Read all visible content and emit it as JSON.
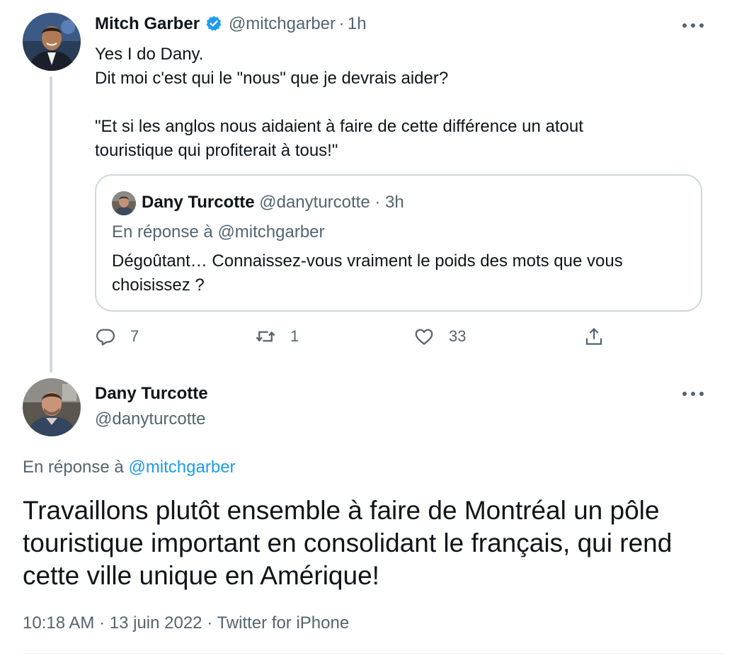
{
  "parent_tweet": {
    "author_name": "Mitch Garber",
    "author_handle": "@mitchgarber",
    "separator": "·",
    "time_ago": "1h",
    "lines": [
      "Yes I do Dany.",
      "Dit moi c'est qui le \"nous\" que je devrais aider?",
      "",
      "\"Et si les anglos nous aidaient à faire de cette différence un atout",
      "touristique qui profiterait à tous!\""
    ],
    "quote": {
      "author_name": "Dany Turcotte",
      "author_handle": "@danyturcotte",
      "separator": "·",
      "time_ago": "3h",
      "reply_to": "En réponse à @mitchgarber",
      "text": "Dégoûtant… Connaissez-vous vraiment le poids des mots que vous choisissez ?"
    },
    "actions": {
      "reply_count": "7",
      "retweet_count": "1",
      "like_count": "33"
    }
  },
  "main_tweet": {
    "author_name": "Dany Turcotte",
    "author_handle": "@danyturcotte",
    "reply_prefix": "En réponse à",
    "reply_mention": "@mitchgarber",
    "text": "Travaillons plutôt ensemble à faire de Montréal un pôle touristique important en consolidant le français, qui rend cette ville unique en Amérique!",
    "time": "10:18 AM",
    "separator1": "·",
    "date": "13 juin 2022",
    "separator2": "·",
    "source": "Twitter for iPhone"
  },
  "colors": {
    "accent": "#1d9bf0",
    "secondary_text": "#536471",
    "border": "#cfd9de",
    "verified": "#1d9bf0"
  },
  "icons": [
    "verified-badge-icon",
    "more-options-icon",
    "reply-icon",
    "retweet-icon",
    "like-icon",
    "share-icon"
  ]
}
